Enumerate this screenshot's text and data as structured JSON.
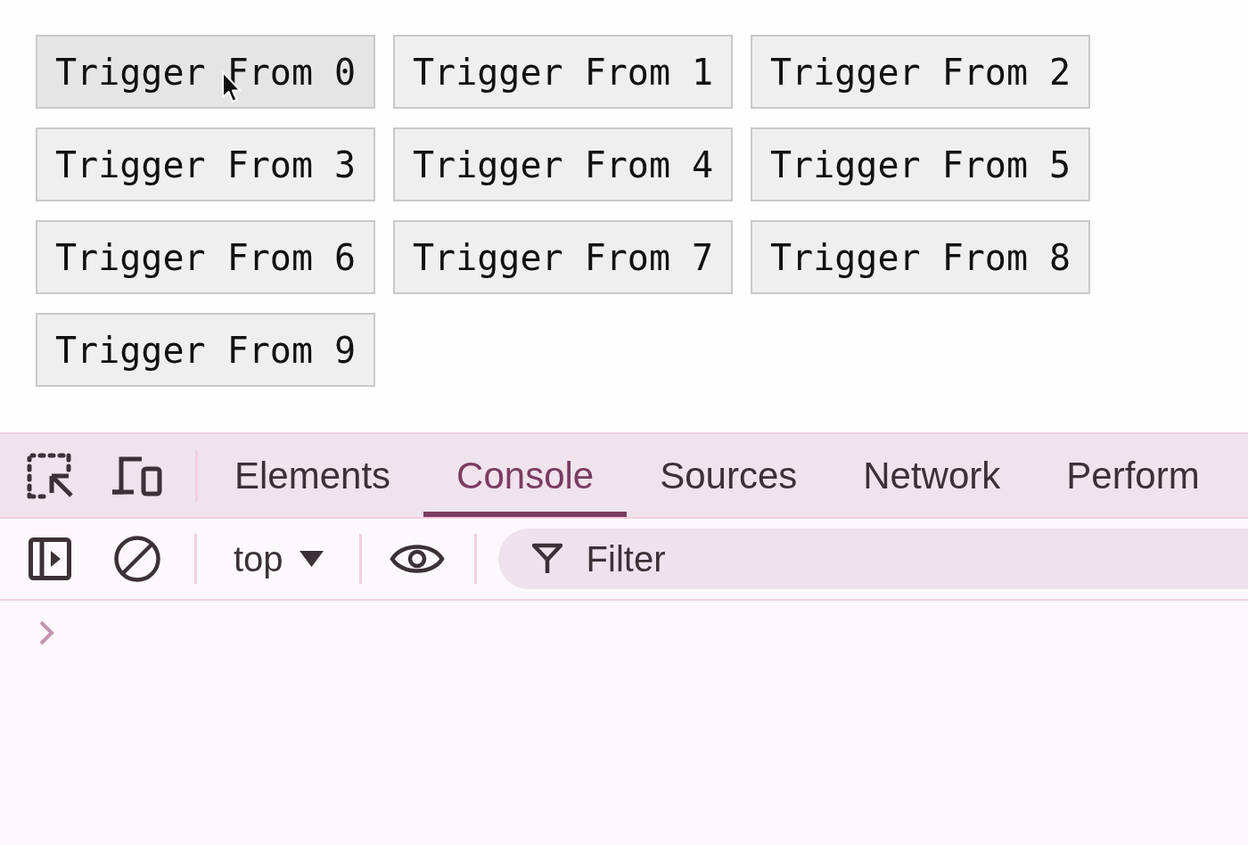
{
  "buttons": [
    {
      "label": "Trigger From 0",
      "hovered": true
    },
    {
      "label": "Trigger From 1",
      "hovered": false
    },
    {
      "label": "Trigger From 2",
      "hovered": false
    },
    {
      "label": "Trigger From 3",
      "hovered": false
    },
    {
      "label": "Trigger From 4",
      "hovered": false
    },
    {
      "label": "Trigger From 5",
      "hovered": false
    },
    {
      "label": "Trigger From 6",
      "hovered": false
    },
    {
      "label": "Trigger From 7",
      "hovered": false
    },
    {
      "label": "Trigger From 8",
      "hovered": false
    },
    {
      "label": "Trigger From 9",
      "hovered": false
    }
  ],
  "devtools": {
    "tabs": [
      {
        "label": "Elements",
        "selected": false
      },
      {
        "label": "Console",
        "selected": true
      },
      {
        "label": "Sources",
        "selected": false
      },
      {
        "label": "Network",
        "selected": false
      },
      {
        "label": "Perform",
        "selected": false
      }
    ],
    "toolbar": {
      "context": "top",
      "filter": {
        "placeholder": "Filter"
      }
    }
  }
}
